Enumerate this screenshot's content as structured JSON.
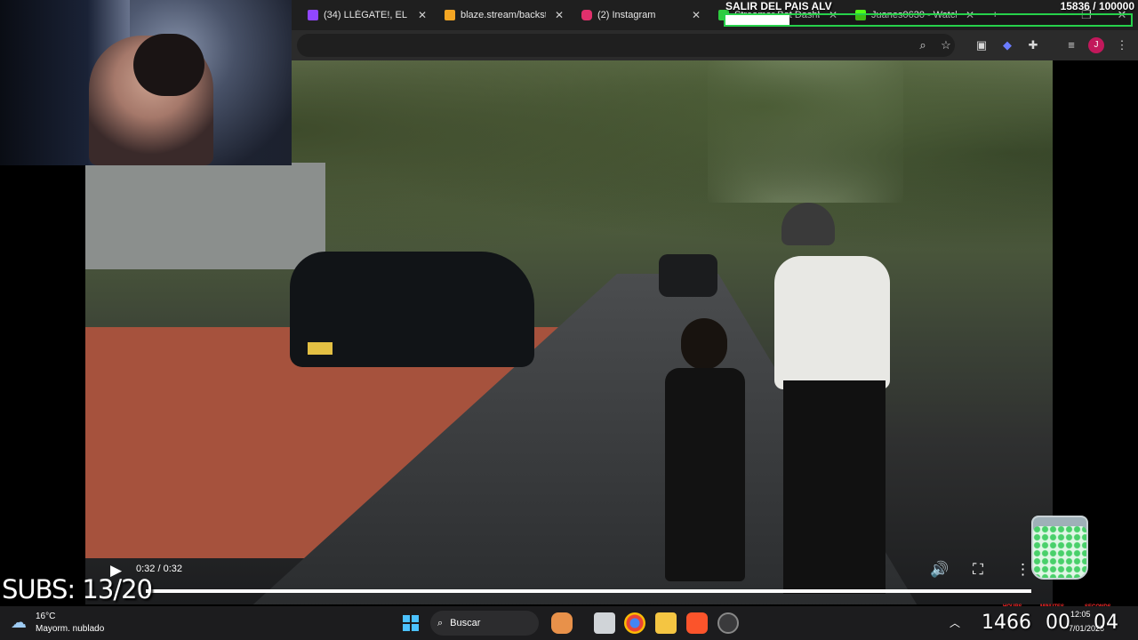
{
  "browser": {
    "tabs": [
      {
        "title": "(34) LLÉGATE!, EL Q NO",
        "icon": "twitch-icon",
        "color": "#9146ff"
      },
      {
        "title": "blaze.stream/backstag",
        "icon": "blaze-icon",
        "color": "#f5a623"
      },
      {
        "title": "(2) Instagram",
        "icon": "instagram-icon",
        "color": "#e1306c"
      },
      {
        "title": "Streamer Bot Dashbo",
        "icon": "streamerbot-icon",
        "color": "#2ecc40"
      },
      {
        "title": "Juanes0630 - Watch c",
        "icon": "kick-icon",
        "color": "#53fc18"
      }
    ],
    "toolbar_icons": [
      "zoom-icon",
      "bookmark-star-icon",
      "media-icon",
      "extension-puzzle-icon",
      "reading-list-icon",
      "profile-avatar-icon",
      "menu-dots-icon"
    ],
    "profile_initial": "J",
    "profile_color": "#c2185b"
  },
  "goal": {
    "title": "SALIR DEL PAIS ALV",
    "count": "15836 / 100000",
    "progress": 0.158,
    "accent": "#26d04a"
  },
  "video": {
    "plate": "JXU 241",
    "time": "0:32 / 0:32",
    "progress": 1.0
  },
  "subs": "SUBS: 13/20",
  "taskbar": {
    "weather_temp": "16°C",
    "weather_desc": "Mayorm. nublado",
    "search_label": "Buscar",
    "time": "12:05",
    "date": "7/01/2026",
    "lang": "LAA"
  },
  "timer": {
    "labels": [
      "HOURS",
      "MINUTES",
      "SECONDS"
    ],
    "hours": "1466",
    "minutes": "00",
    "seconds": "04",
    "label_color": "#ff2a2a"
  }
}
